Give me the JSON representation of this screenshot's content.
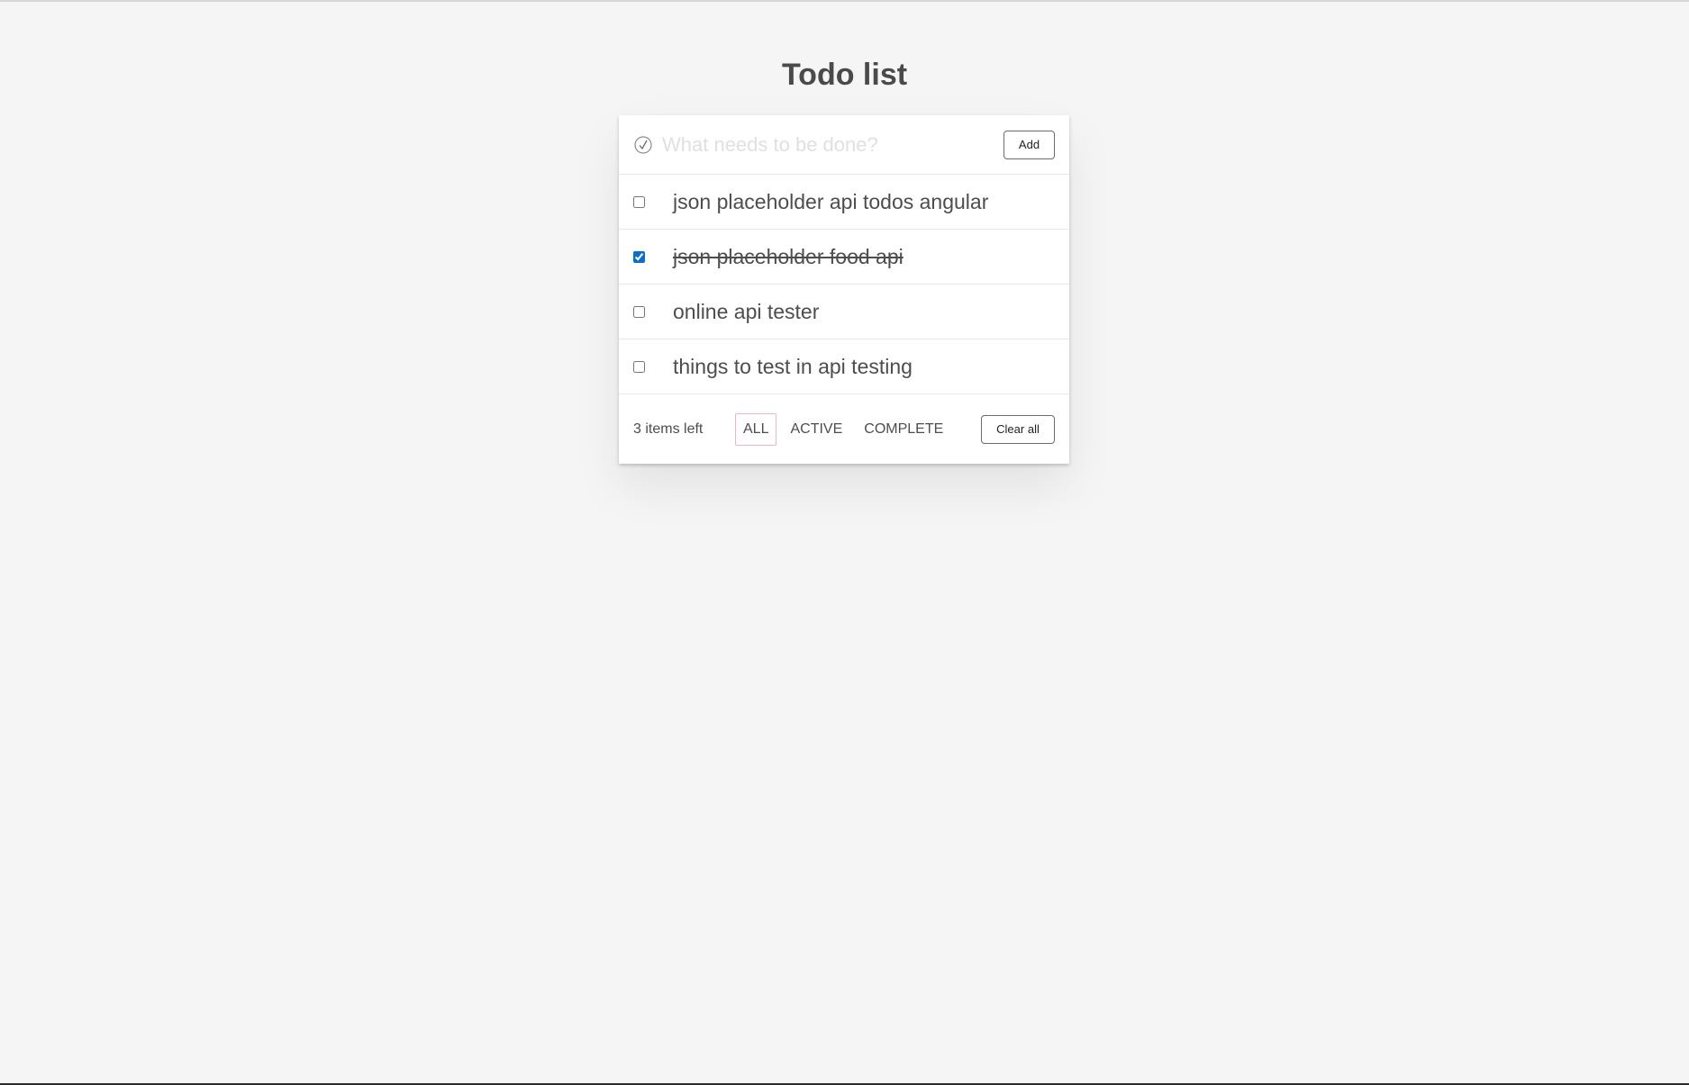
{
  "page": {
    "title": "Todo list"
  },
  "new_todo": {
    "icon": "check-circle-icon",
    "placeholder": "What needs to be done?",
    "value": "",
    "add_label": "Add"
  },
  "todos": [
    {
      "label": "json placeholder api todos angular",
      "completed": false
    },
    {
      "label": "json placeholder food api",
      "completed": true
    },
    {
      "label": "online api tester",
      "completed": false
    },
    {
      "label": "things to test in api testing",
      "completed": false
    }
  ],
  "footer": {
    "items_left": "3 items left",
    "filters": [
      {
        "label": "ALL",
        "selected": true
      },
      {
        "label": "ACTIVE",
        "selected": false
      },
      {
        "label": "COMPLETE",
        "selected": false
      }
    ],
    "clear_label": "Clear all"
  },
  "colors": {
    "background": "#f5f5f5",
    "checkbox_accent": "#0a6ed1",
    "selected_filter_border": "#efb3c5"
  }
}
